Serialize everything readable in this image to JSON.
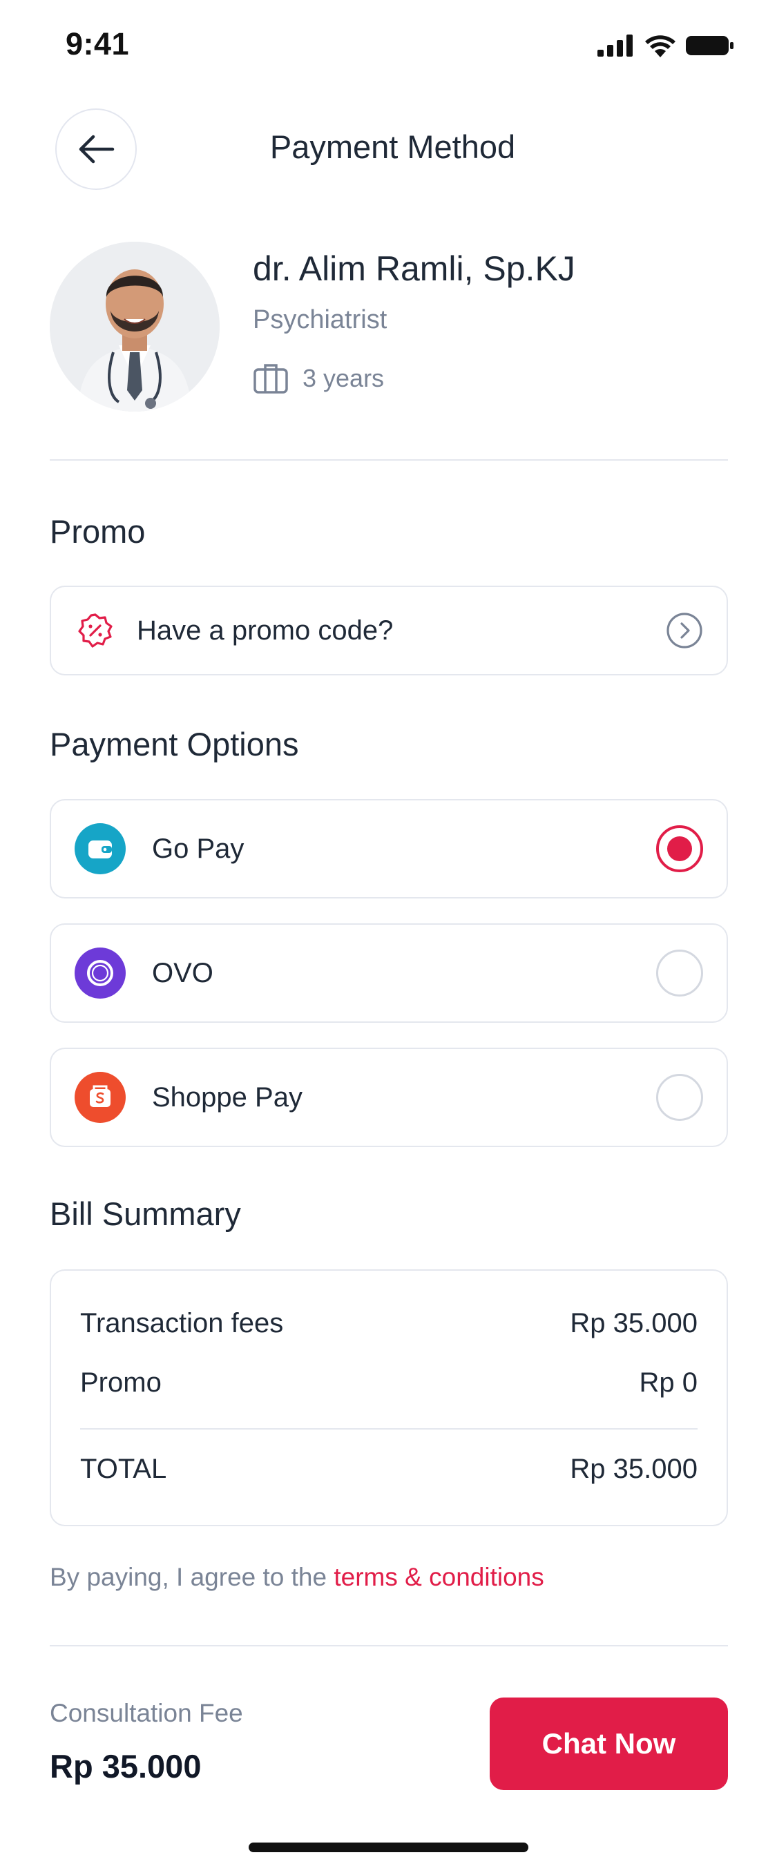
{
  "status_bar": {
    "time": "9:41"
  },
  "header": {
    "title": "Payment Method"
  },
  "doctor": {
    "name": "dr. Alim Ramli, Sp.KJ",
    "specialty": "Psychiatrist",
    "experience": "3 years"
  },
  "promo": {
    "section_title": "Promo",
    "prompt": "Have a promo code?"
  },
  "payment": {
    "section_title": "Payment Options",
    "options": [
      {
        "label": "Go Pay",
        "selected": true,
        "color": "#16a5c7"
      },
      {
        "label": "OVO",
        "selected": false,
        "color": "#6d3ad8"
      },
      {
        "label": "Shoppe Pay",
        "selected": false,
        "color": "#ee4d2d"
      }
    ]
  },
  "bill": {
    "section_title": "Bill Summary",
    "rows": [
      {
        "label": "Transaction fees",
        "value": "Rp 35.000"
      },
      {
        "label": "Promo",
        "value": "Rp 0"
      }
    ],
    "total": {
      "label": "TOTAL",
      "value": "Rp 35.000"
    }
  },
  "terms": {
    "prefix": "By paying, I agree to the ",
    "link": "terms & conditions"
  },
  "footer": {
    "fee_label": "Consultation Fee",
    "fee_value": "Rp 35.000",
    "cta": "Chat Now"
  },
  "colors": {
    "accent": "#e11d48",
    "border": "#e4e7ee",
    "muted": "#7a8496"
  }
}
